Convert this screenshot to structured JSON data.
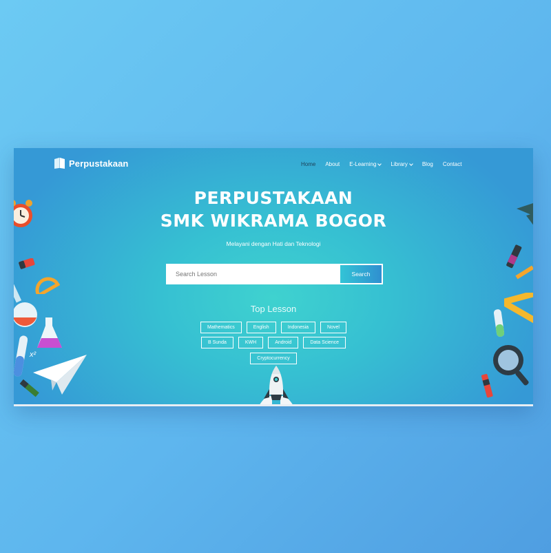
{
  "brand": {
    "name": "Perpustakaan",
    "icon": "book-icon"
  },
  "nav": {
    "items": [
      {
        "label": "Home",
        "active": true,
        "dropdown": false
      },
      {
        "label": "About",
        "active": false,
        "dropdown": false
      },
      {
        "label": "E-Learning",
        "active": false,
        "dropdown": true
      },
      {
        "label": "Library",
        "active": false,
        "dropdown": true
      },
      {
        "label": "Blog",
        "active": false,
        "dropdown": false
      },
      {
        "label": "Contact",
        "active": false,
        "dropdown": false
      }
    ]
  },
  "hero": {
    "title_line1": "PERPUSTAKAAN",
    "title_line2": "SMK WIKRAMA BOGOR",
    "tagline": "Melayani dengan Hati dan Teknologi"
  },
  "search": {
    "placeholder": "Search Lesson",
    "value": "",
    "button_label": "Search"
  },
  "top_lesson": {
    "title": "Top Lesson",
    "rows": [
      [
        "Mathematics",
        "English",
        "Indonesia",
        "Novel"
      ],
      [
        "B Sunda",
        "KWH",
        "Android",
        "Data Science"
      ],
      [
        "Cryptocurrency"
      ]
    ]
  },
  "decor": {
    "math_symbol": "x²"
  },
  "colors": {
    "hero_center": "#3fd2cf",
    "hero_edge": "#3599d6",
    "button": "#2f8fd0",
    "active_nav": "#1e3f55"
  }
}
